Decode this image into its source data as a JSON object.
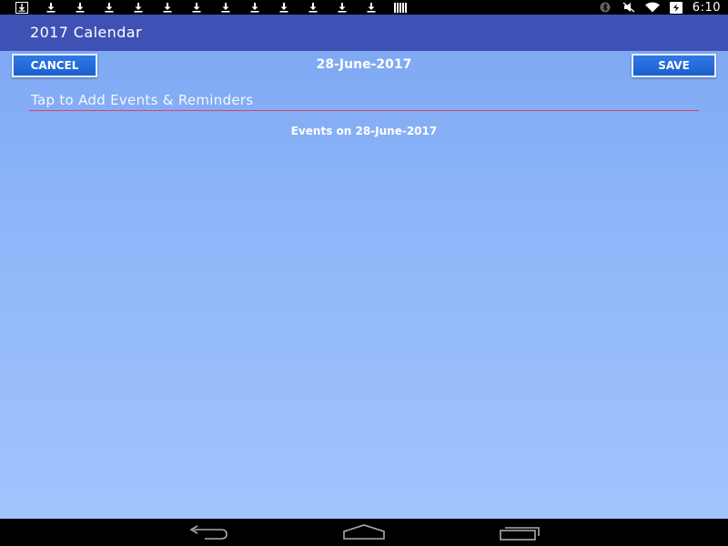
{
  "status_bar": {
    "left_icons": [
      "download-box-icon",
      "download-icon",
      "download-icon",
      "download-icon",
      "download-icon",
      "download-icon",
      "download-icon",
      "download-icon",
      "download-icon",
      "download-icon",
      "download-icon",
      "download-icon",
      "download-icon",
      "storage-icon"
    ],
    "right_icons": [
      "bluetooth-icon",
      "muted-icon",
      "wifi-icon",
      "battery-icon"
    ],
    "time": "6:10"
  },
  "app_bar": {
    "title": "2017 Calendar",
    "color": "#3f51b5"
  },
  "toolbar": {
    "cancel_label": "CANCEL",
    "save_label": "SAVE",
    "date": "28-June-2017"
  },
  "event_input": {
    "placeholder": "Tap to Add Events & Reminders",
    "value": ""
  },
  "events_section": {
    "heading": "Events on 28-June-2017"
  },
  "colors": {
    "background_top": "#7fa9f3",
    "background_bottom": "#a2c4fd",
    "button": "#1c5fcf",
    "input_underline": "#e0426a"
  },
  "nav_bar": {
    "icons": [
      "back-icon",
      "home-icon",
      "recent-apps-icon"
    ]
  }
}
